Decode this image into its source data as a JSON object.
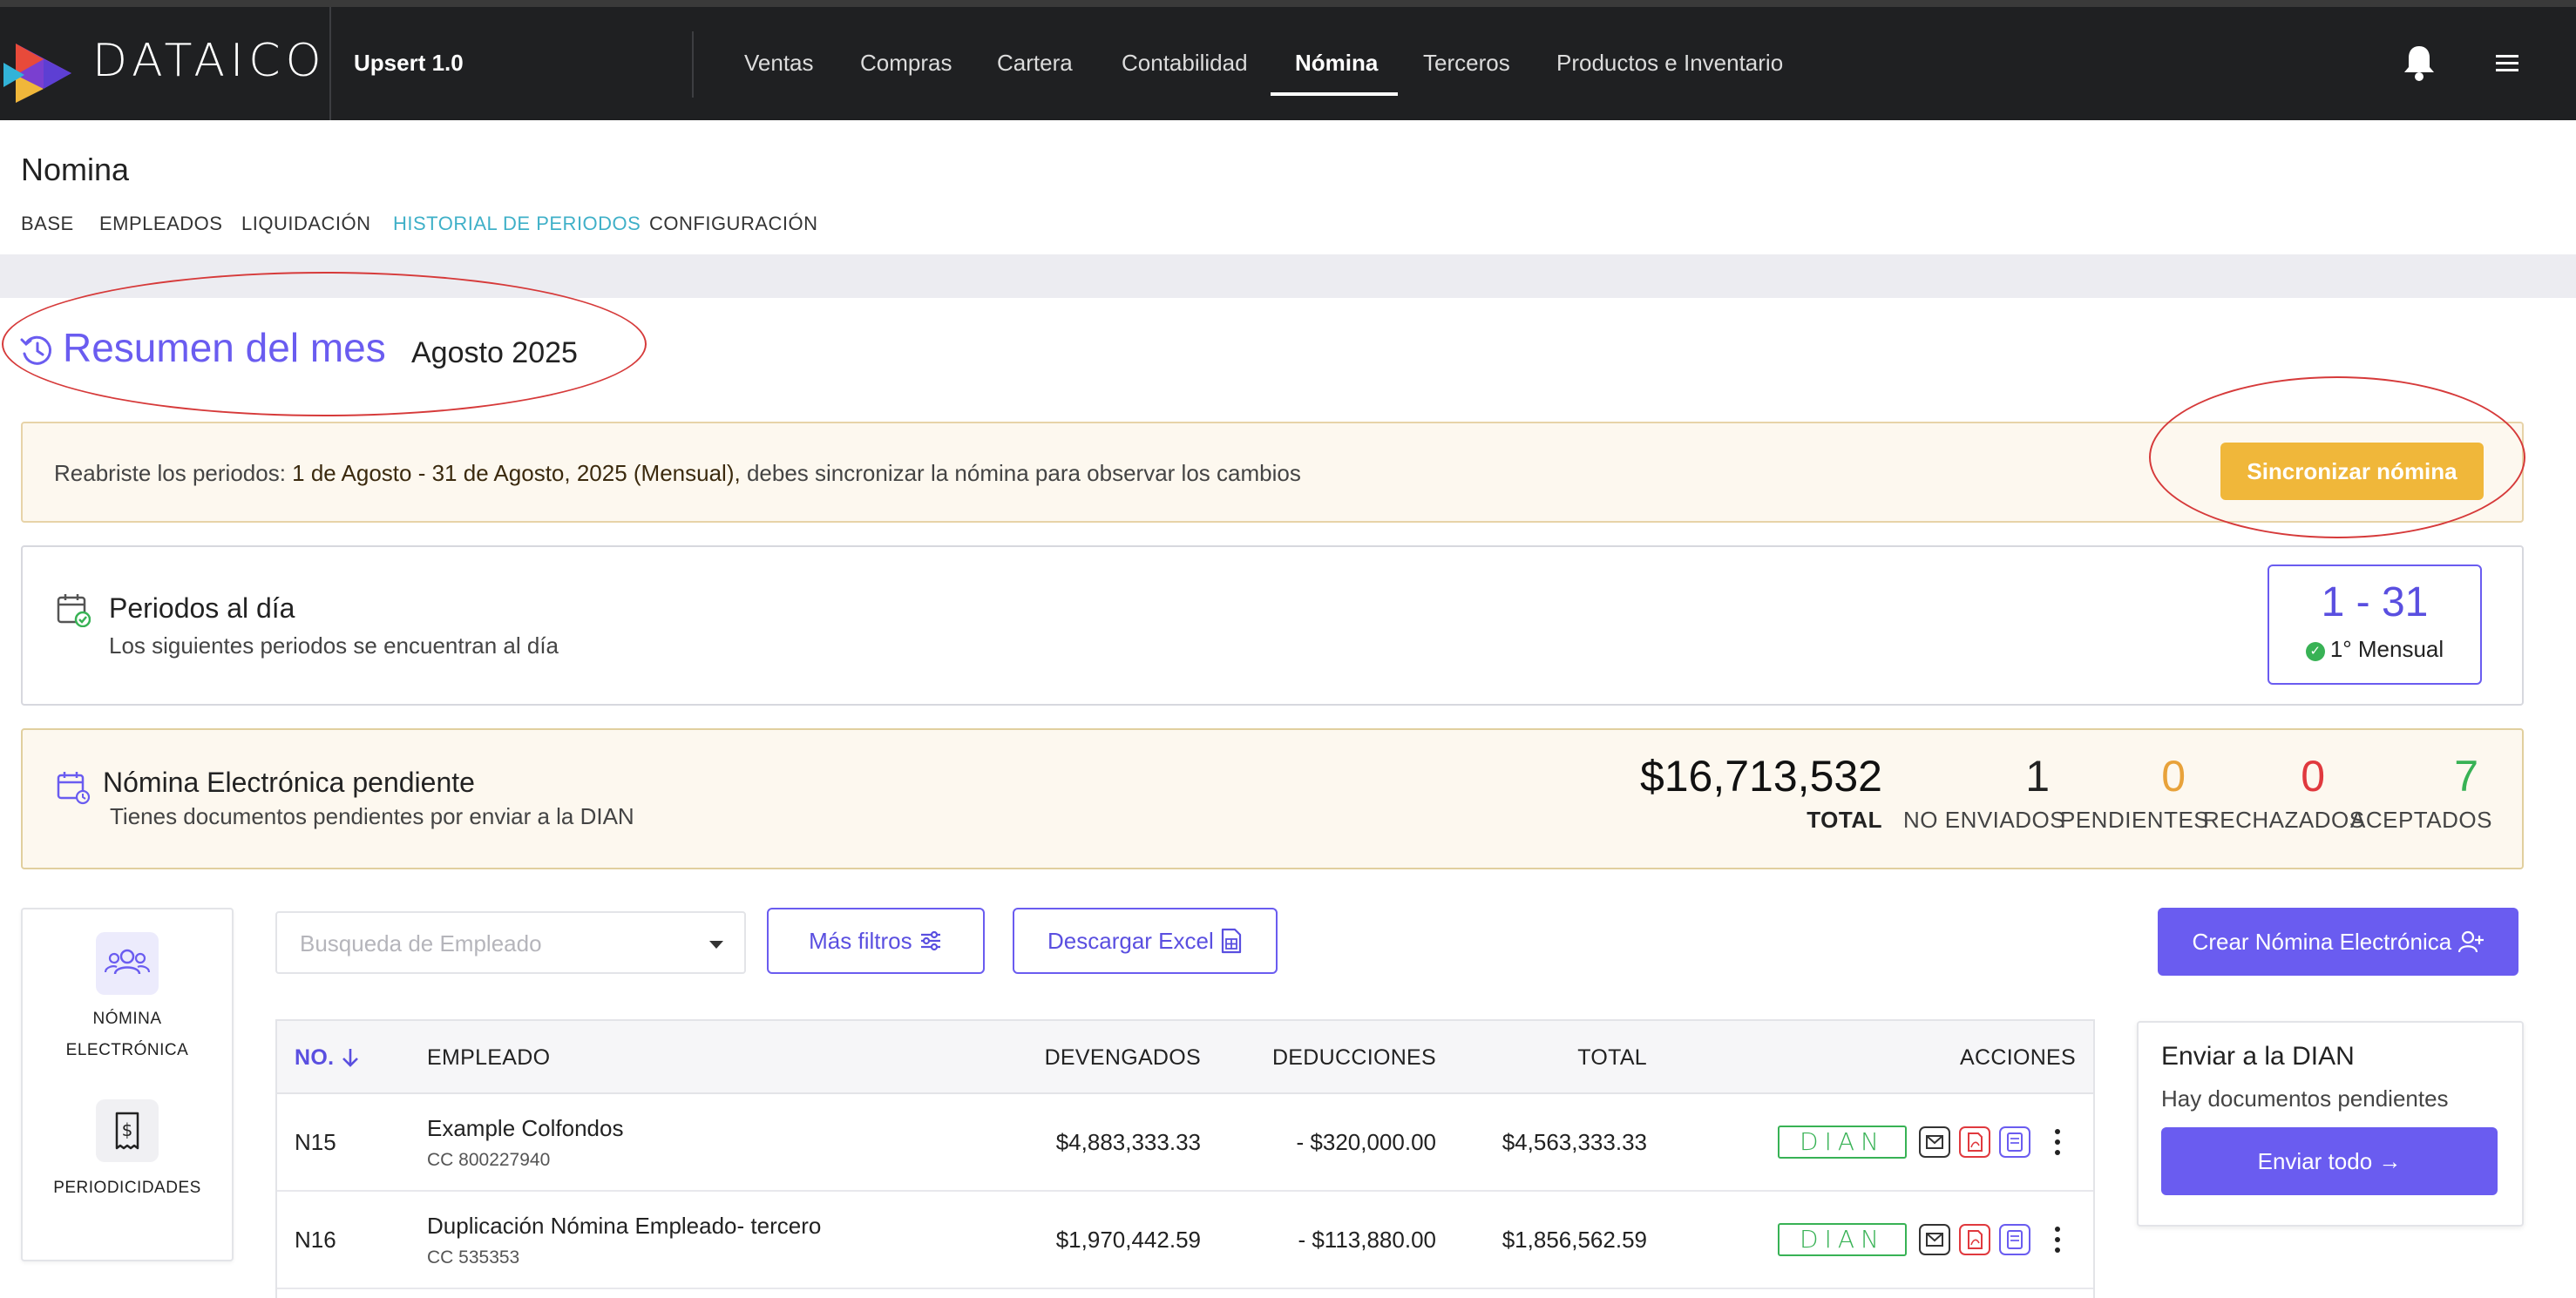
{
  "app": {
    "brand": "DATAICO",
    "company": "Upsert 1.0"
  },
  "nav": {
    "items": [
      "Ventas",
      "Compras",
      "Cartera",
      "Contabilidad",
      "Nómina",
      "Terceros",
      "Productos e Inventario"
    ],
    "active": "Nómina"
  },
  "page": {
    "title": "Nomina",
    "tabs": [
      "BASE",
      "EMPLEADOS",
      "LIQUIDACIÓN",
      "HISTORIAL DE PERIODOS",
      "CONFIGURACIÓN"
    ],
    "active_tab": "HISTORIAL DE PERIODOS"
  },
  "resumen": {
    "title": "Resumen del mes",
    "month": "Agosto 2025"
  },
  "alert": {
    "prefix": "Reabriste los periodos: ",
    "period": "1 de Agosto - 31 de Agosto, 2025 (Mensual),",
    "suffix": " debes sincronizar la nómina para observar los cambios",
    "button": "Sincronizar nómina"
  },
  "periodos": {
    "title": "Periodos al día",
    "subtitle": "Los siguientes periodos se encuentran al día",
    "range": "1 - 31",
    "label": "1° Mensual"
  },
  "pendiente": {
    "title": "Nómina Electrónica pendiente",
    "subtitle": "Tienes documentos pendientes por enviar a la DIAN",
    "total_value": "$16,713,532",
    "total_label": "TOTAL",
    "stats": [
      {
        "value": "1",
        "label": "NO ENVIADOS",
        "color": "#222222"
      },
      {
        "value": "0",
        "label": "PENDIENTES",
        "color": "#e8a23a"
      },
      {
        "value": "0",
        "label": "RECHAZADOS",
        "color": "#e0393e"
      },
      {
        "value": "7",
        "label": "ACEPTADOS",
        "color": "#38b255"
      }
    ]
  },
  "sidebar": {
    "items": [
      {
        "line1": "NÓMINA",
        "line2": "ELECTRÓNICA"
      },
      {
        "line1": "PERIODICIDADES",
        "line2": ""
      }
    ]
  },
  "filters": {
    "search_placeholder": "Busqueda de Empleado",
    "more_filters": "Más filtros",
    "download_excel": "Descargar Excel",
    "create": "Crear Nómina Electrónica"
  },
  "table": {
    "headers": [
      "NO.",
      "EMPLEADO",
      "DEVENGADOS",
      "DEDUCCIONES",
      "TOTAL",
      "ACCIONES"
    ],
    "rows": [
      {
        "no": "N15",
        "name": "Example Colfondos",
        "doc": "CC 800227940",
        "devengados": "$4,883,333.33",
        "deducciones": "- $320,000.00",
        "total": "$4,563,333.33",
        "badge": "DIAN"
      },
      {
        "no": "N16",
        "name": "Duplicación Nómina Empleado- tercero",
        "doc": "CC 535353",
        "devengados": "$1,970,442.59",
        "deducciones": "- $113,880.00",
        "total": "$1,856,562.59",
        "badge": "DIAN"
      }
    ]
  },
  "enviar": {
    "title": "Enviar a la DIAN",
    "subtitle": "Hay documentos pendientes",
    "button": "Enviar todo →"
  },
  "colors": {
    "accent": "#6a5cf0",
    "warning_button": "#f0b73a",
    "navbar": "#1f2022",
    "success": "#38b255",
    "danger": "#e0393e"
  }
}
